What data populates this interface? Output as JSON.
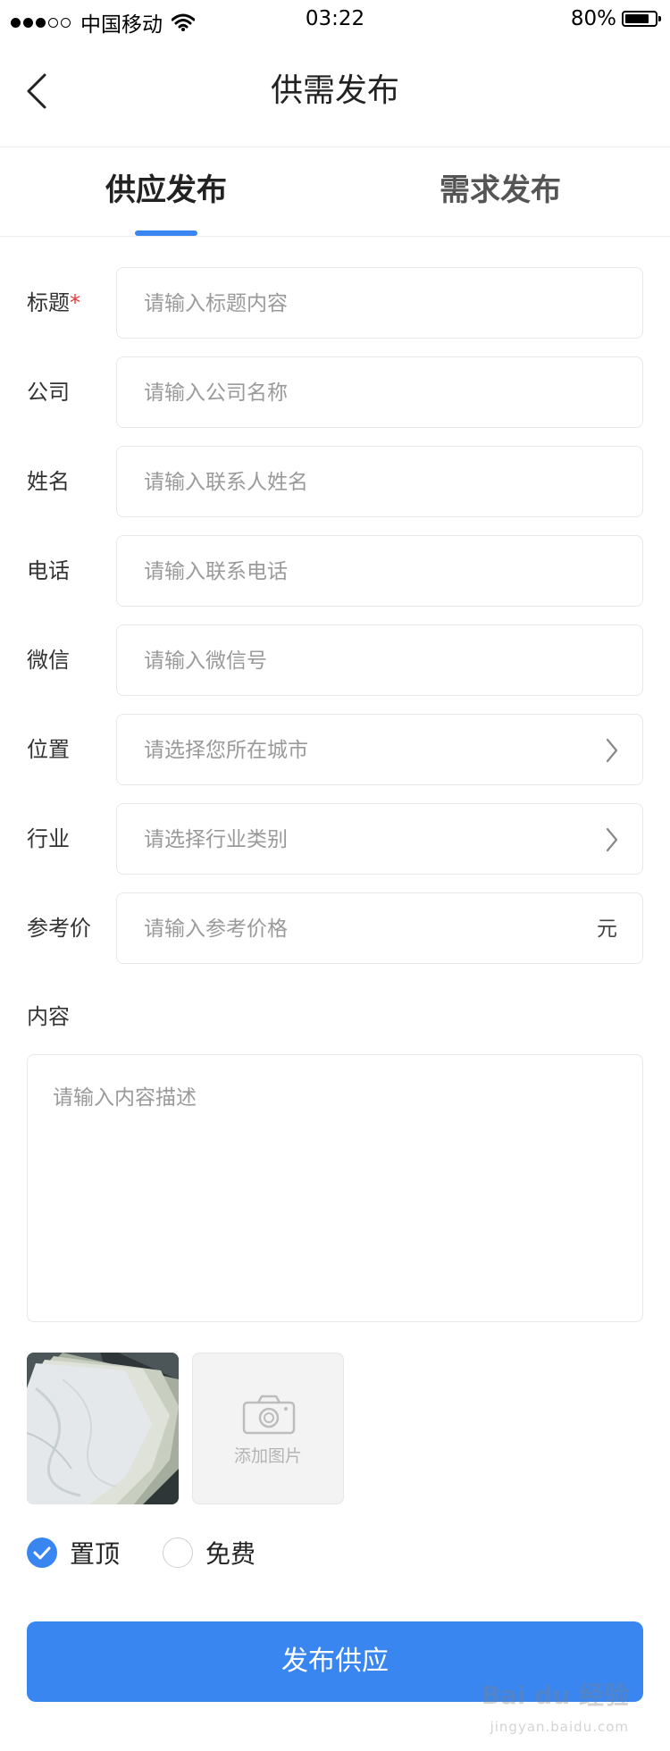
{
  "status_bar": {
    "carrier": "中国移动",
    "time": "03:22",
    "battery": "80%",
    "battery_level": 0.8,
    "signal_filled": 3,
    "signal_total": 5
  },
  "nav": {
    "back_icon": "chevron-left-icon",
    "title": "供需发布"
  },
  "tabs": [
    {
      "label": "供应发布",
      "active": true
    },
    {
      "label": "需求发布",
      "active": false
    }
  ],
  "form": {
    "title": {
      "label": "标题",
      "required_mark": "*",
      "placeholder": "请输入标题内容",
      "value": ""
    },
    "company": {
      "label": "公司",
      "placeholder": "请输入公司名称",
      "value": ""
    },
    "name": {
      "label": "姓名",
      "placeholder": "请输入联系人姓名",
      "value": ""
    },
    "phone": {
      "label": "电话",
      "placeholder": "请输入联系电话",
      "value": ""
    },
    "wechat": {
      "label": "微信",
      "placeholder": "请输入微信号",
      "value": ""
    },
    "location": {
      "label": "位置",
      "placeholder": "请选择您所在城市",
      "value": ""
    },
    "industry": {
      "label": "行业",
      "placeholder": "请选择行业类别",
      "value": ""
    },
    "price": {
      "label": "参考价",
      "placeholder": "请输入参考价格",
      "unit": "元",
      "value": ""
    },
    "content": {
      "label": "内容",
      "placeholder": "请输入内容描述",
      "value": ""
    }
  },
  "images": {
    "add_label": "添加图片",
    "camera_icon": "camera-icon"
  },
  "options": [
    {
      "label": "置顶",
      "checked": true
    },
    {
      "label": "免费",
      "checked": false
    }
  ],
  "submit_label": "发布供应",
  "watermark": {
    "logo": "Bai du 经验",
    "url": "jingyan.baidu.com"
  },
  "colors": {
    "accent": "#3a86f0",
    "required": "#e53935",
    "placeholder": "#9a9a9a"
  }
}
